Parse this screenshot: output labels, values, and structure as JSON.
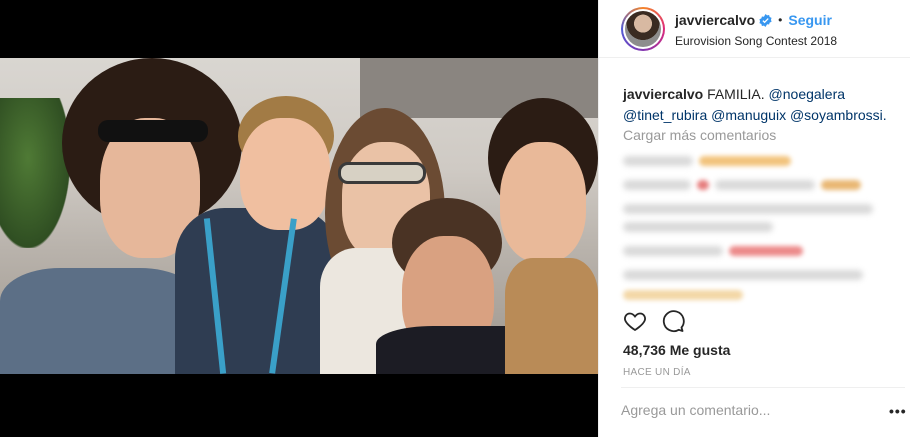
{
  "post": {
    "username": "javviercalvo",
    "follow_label": "Seguir",
    "location": "Eurovision Song Contest 2018",
    "separator": "•"
  },
  "caption": {
    "author": "javviercalvo",
    "text": "FAMILIA.",
    "mentions": [
      "@noegalera",
      "@tinet_rubira",
      "@manuguix",
      "@soyambrossi."
    ]
  },
  "comments": {
    "load_more": "Cargar más comentarios"
  },
  "engagement": {
    "likes": "48,736 Me gusta",
    "timestamp": "HACE UN DÍA"
  },
  "composer": {
    "placeholder": "Agrega un comentario...",
    "more_label": "•••"
  },
  "icons": {
    "like": "heart-icon",
    "comment": "comment-icon",
    "verified": "verified-badge-icon"
  },
  "colors": {
    "link": "#3897f0",
    "mention": "#003569",
    "muted": "#999999"
  }
}
